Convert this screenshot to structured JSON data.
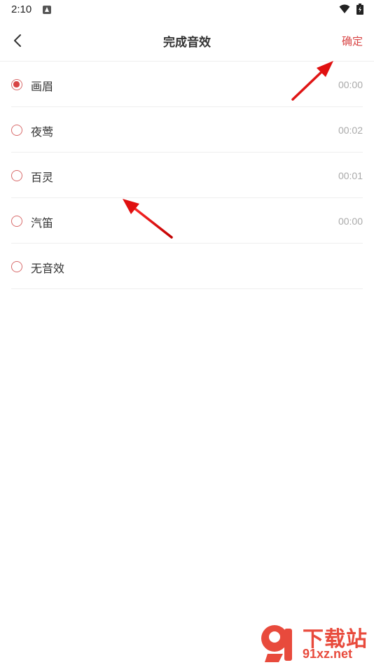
{
  "status_bar": {
    "time": "2:10"
  },
  "header": {
    "title": "完成音效",
    "confirm_label": "确定"
  },
  "sounds": [
    {
      "name": "画眉",
      "duration": "00:00",
      "selected": true
    },
    {
      "name": "夜莺",
      "duration": "00:02",
      "selected": false
    },
    {
      "name": "百灵",
      "duration": "00:01",
      "selected": false
    },
    {
      "name": "汽笛",
      "duration": "00:00",
      "selected": false
    },
    {
      "name": "无音效",
      "duration": "",
      "selected": false
    }
  ],
  "watermark": {
    "title": "下载站",
    "url": "91xz.net"
  },
  "colors": {
    "accent": "#d84444",
    "divider": "#eeeeee",
    "duration_text": "#aaaaaa",
    "annotation_arrow": "#e01010"
  }
}
